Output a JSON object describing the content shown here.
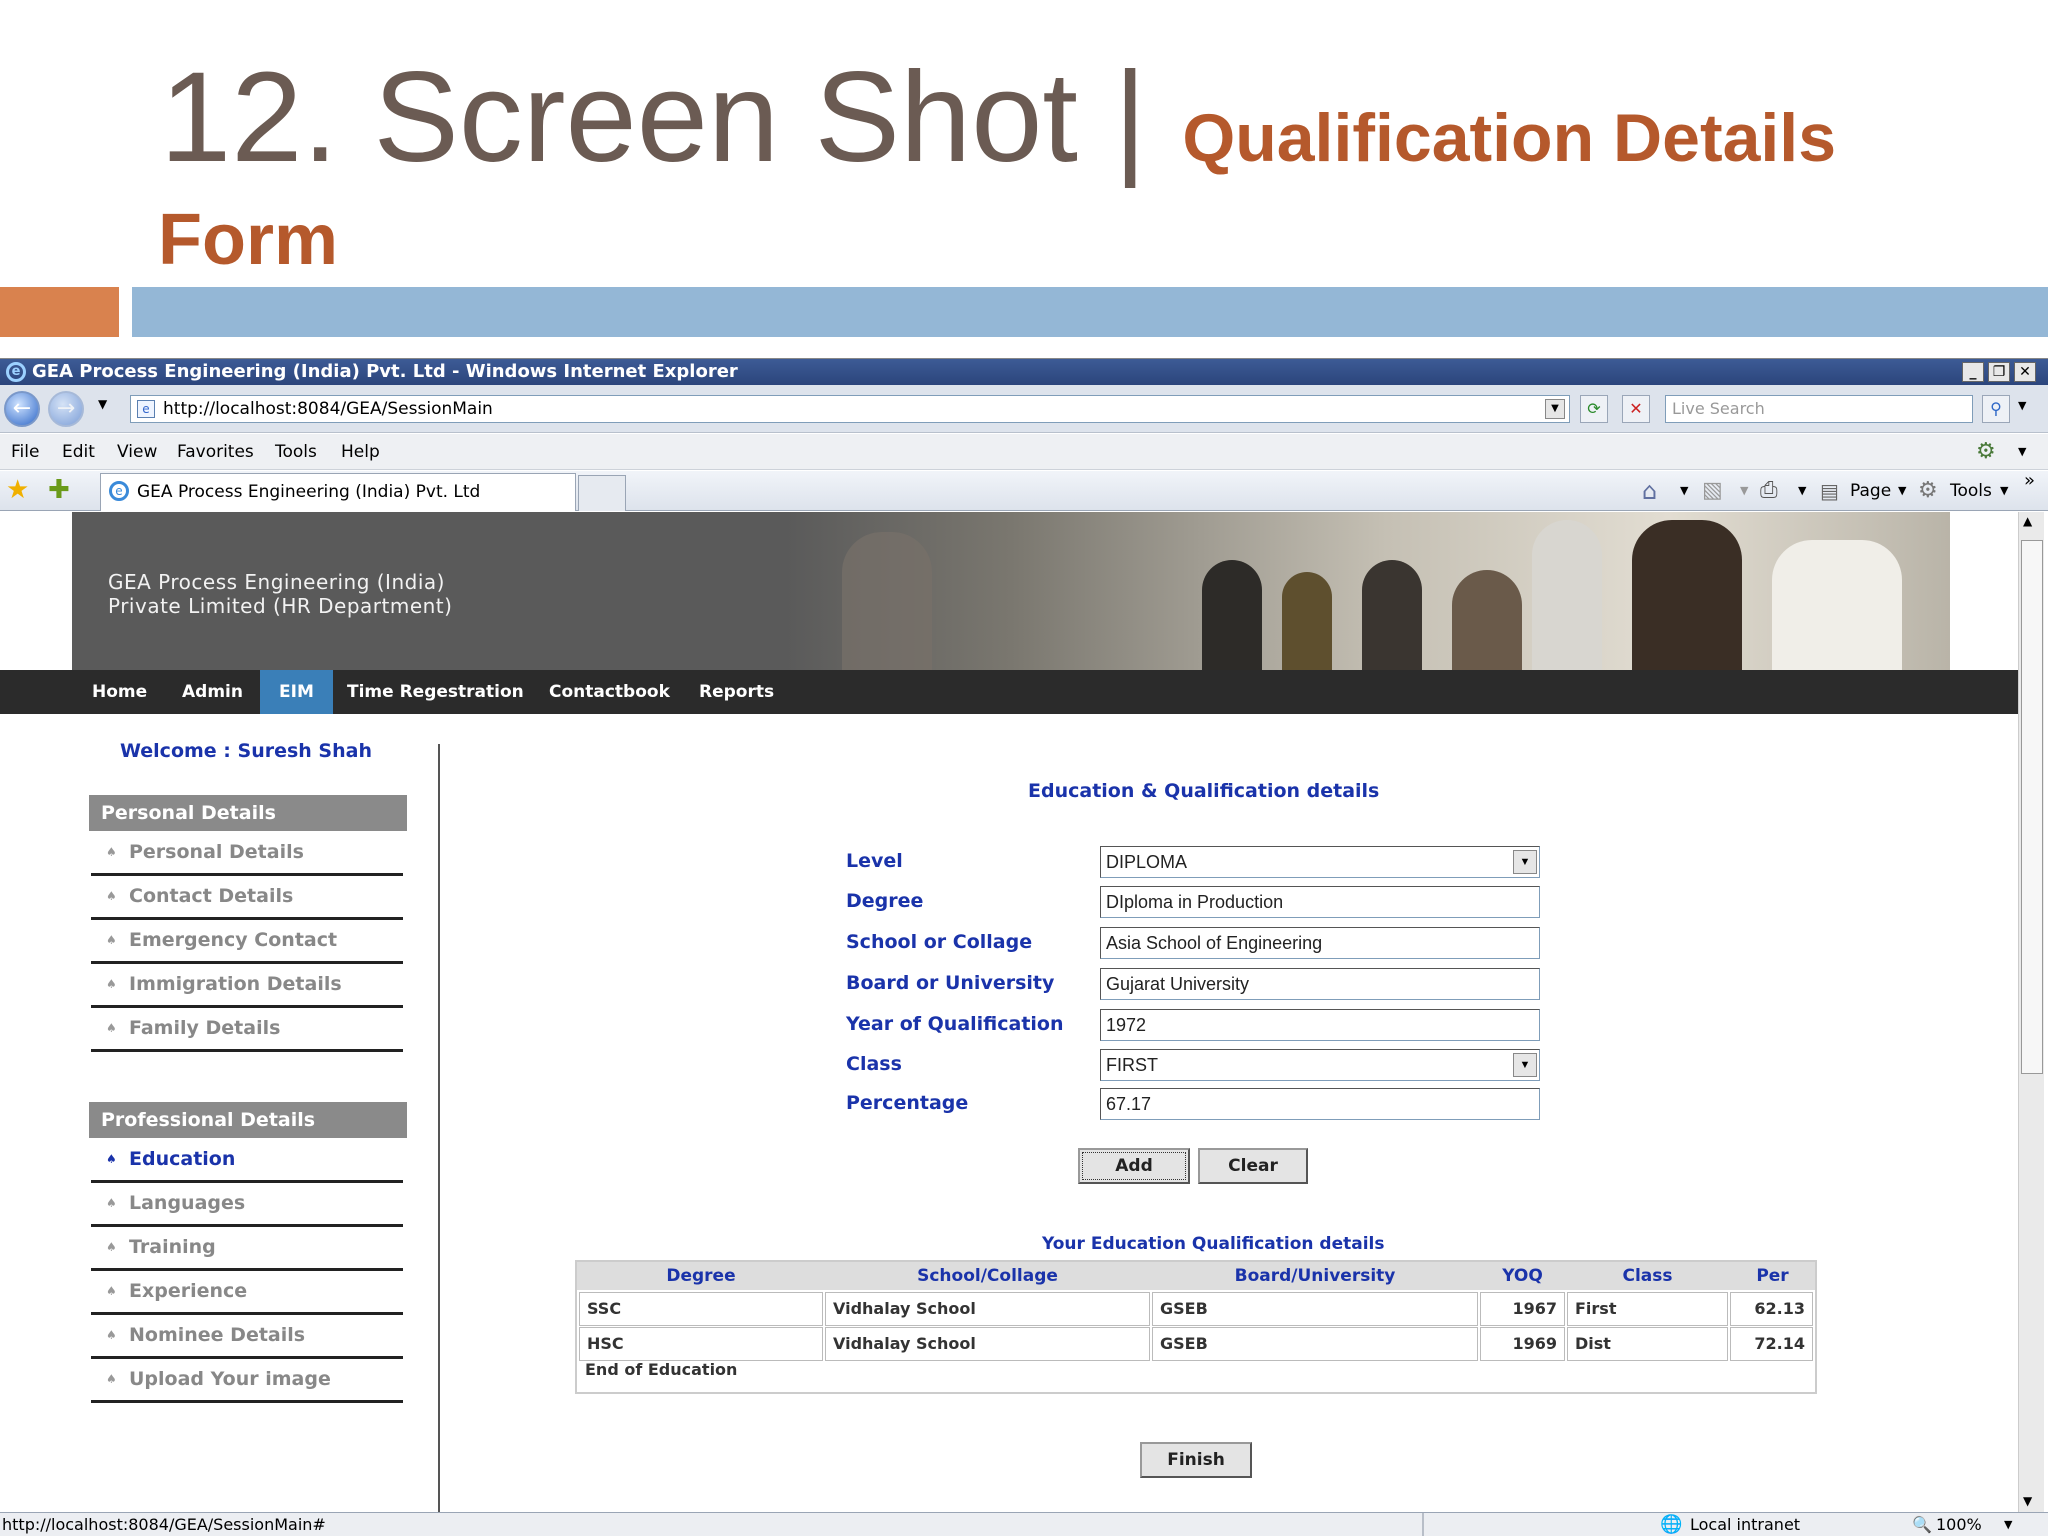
{
  "slide": {
    "title_main": "12. Screen Shot | ",
    "title_sub": "Qualification Details",
    "title_sub2": "Form",
    "accent_colors": {
      "orange": "#d9824e",
      "blue": "#94b7d6"
    }
  },
  "browser": {
    "window_title": "GEA Process Engineering (India) Pvt. Ltd - Windows Internet Explorer",
    "url": "http://localhost:8084/GEA/SessionMain",
    "search_placeholder": "Live Search",
    "menu": [
      "File",
      "Edit",
      "View",
      "Favorites",
      "Tools",
      "Help"
    ],
    "tab_title": "GEA Process Engineering (India) Pvt. Ltd",
    "command_page": "Page",
    "command_tools": "Tools",
    "status_url": "http://localhost:8084/GEA/SessionMain#",
    "status_zone": "Local intranet",
    "zoom": "100%"
  },
  "site": {
    "company_line1": "GEA Process Engineering (India)",
    "company_line2": "Private Limited (HR Department)",
    "nav": [
      "Home",
      "Admin",
      "EIM",
      "Time Regestration",
      "Contactbook",
      "Reports"
    ],
    "nav_active": "EIM",
    "welcome": "Welcome : Suresh Shah",
    "personal_heading": "Personal Details",
    "personal_items": [
      "Personal Details",
      "Contact Details",
      "Emergency Contact",
      "Immigration Details",
      "Family Details"
    ],
    "professional_heading": "Professional Details",
    "professional_items": [
      "Education",
      "Languages",
      "Training",
      "Experience",
      "Nominee Details",
      "Upload Your image"
    ],
    "professional_active": "Education"
  },
  "form": {
    "title": "Education & Qualification details",
    "labels": {
      "level": "Level",
      "degree": "Degree",
      "school": "School or Collage",
      "board": "Board or University",
      "year": "Year of Qualification",
      "class": "Class",
      "percentage": "Percentage"
    },
    "values": {
      "level": "DIPLOMA",
      "degree": "DIploma in Production",
      "school": "Asia School of Engineering",
      "board": "Gujarat University",
      "year": "1972",
      "class": "FIRST",
      "percentage": "67.17"
    },
    "add_label": "Add",
    "clear_label": "Clear",
    "finish_label": "Finish"
  },
  "table": {
    "caption": "Your Education Qualification details",
    "headers": [
      "Degree",
      "School/Collage",
      "Board/University",
      "YOQ",
      "Class",
      "Per"
    ],
    "rows": [
      [
        "SSC",
        "Vidhalay School",
        "GSEB",
        "1967",
        "First",
        "62.13"
      ],
      [
        "HSC",
        "Vidhalay School",
        "GSEB",
        "1969",
        "Dist",
        "72.14"
      ]
    ],
    "footer": "End of Education"
  }
}
